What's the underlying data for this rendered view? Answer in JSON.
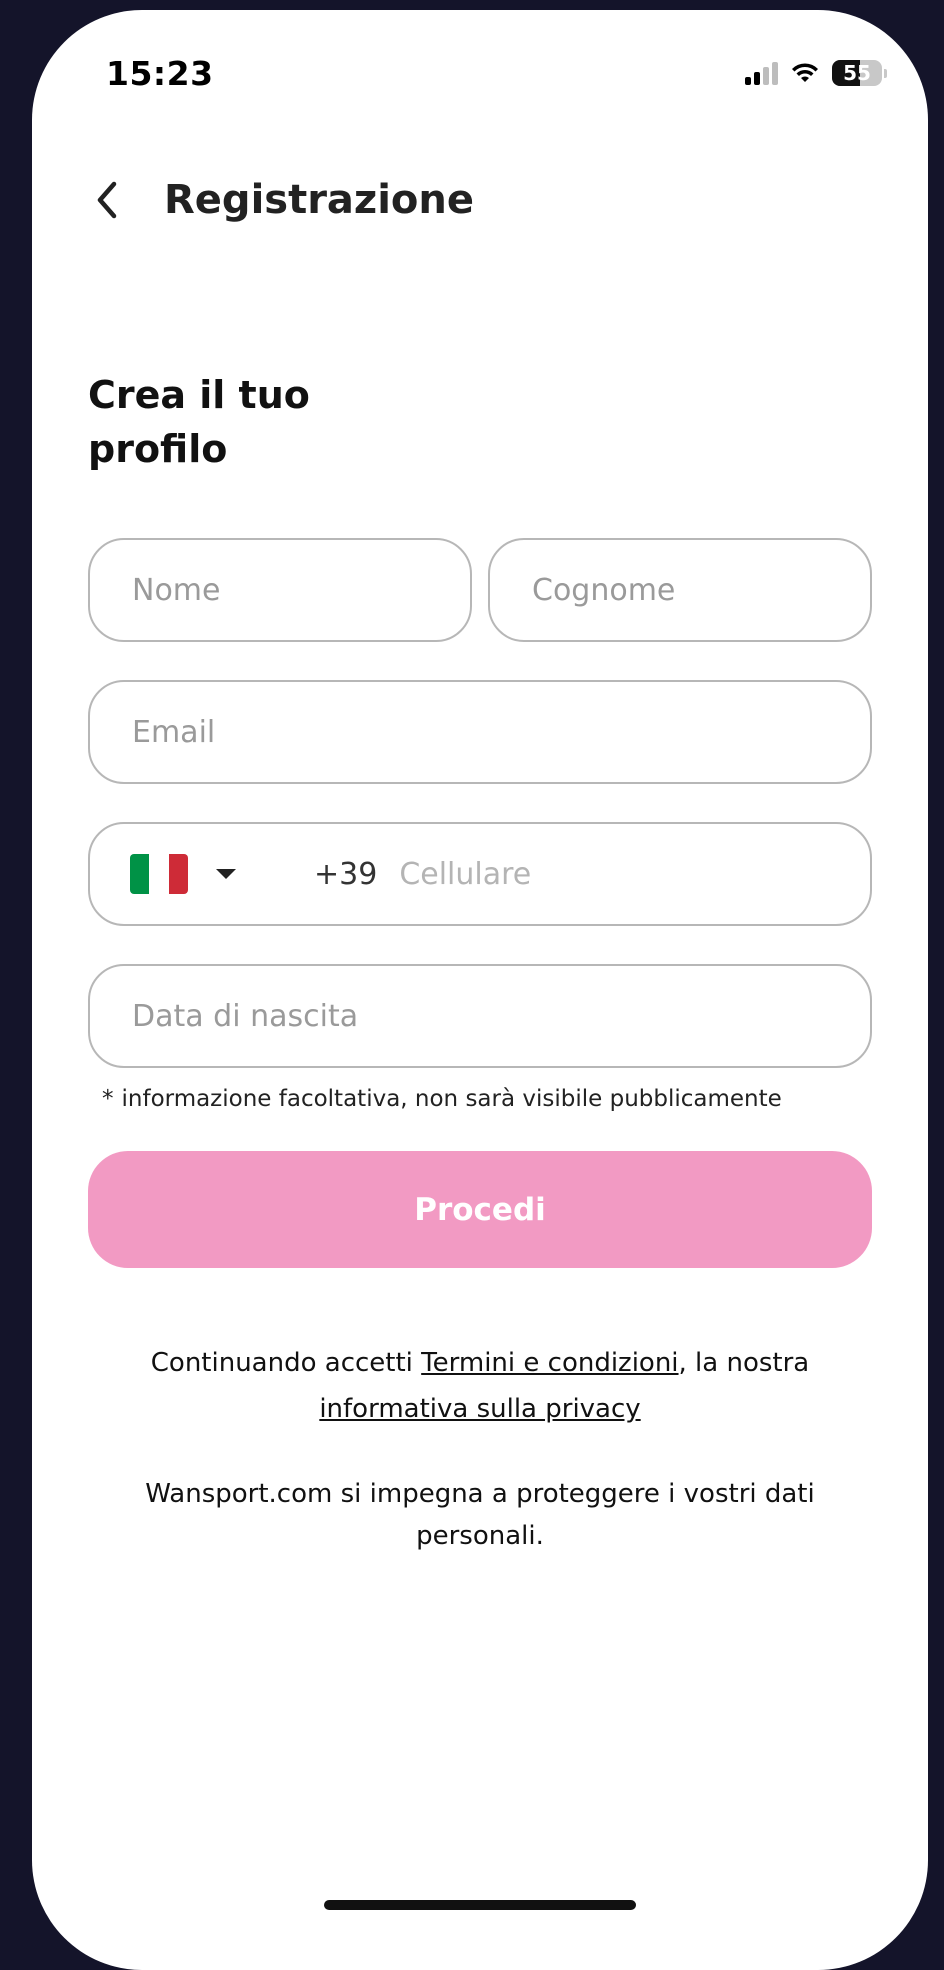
{
  "status_bar": {
    "time": "15:23",
    "battery": "55"
  },
  "header": {
    "title": "Registrazione"
  },
  "heading": {
    "line1": "Crea il tuo",
    "line2": "profilo"
  },
  "form": {
    "first_name_placeholder": "Nome",
    "last_name_placeholder": "Cognome",
    "email_placeholder": "Email",
    "phone_prefix": "+39",
    "phone_placeholder": "Cellulare",
    "dob_placeholder": "Data di nascita",
    "hint_star": "*",
    "hint_text": "informazione facoltativa, non sarà visibile pubblicamente",
    "submit_label": "Procedi"
  },
  "legal": {
    "prefix": "Continuando accetti ",
    "terms_link": "Termini e condizioni",
    "middle": ", la nostra ",
    "privacy_link": "informativa sulla privacy",
    "protection_text": "Wansport.com si impegna a proteggere i vostri dati personali."
  },
  "icons": {
    "back": "chevron-left-icon",
    "flag": "italy-flag-icon",
    "dropdown": "caret-down-icon"
  },
  "colors": {
    "accent": "#f29ac3",
    "flag_green": "#009246",
    "flag_white": "#ffffff",
    "flag_red": "#ce2b37"
  }
}
